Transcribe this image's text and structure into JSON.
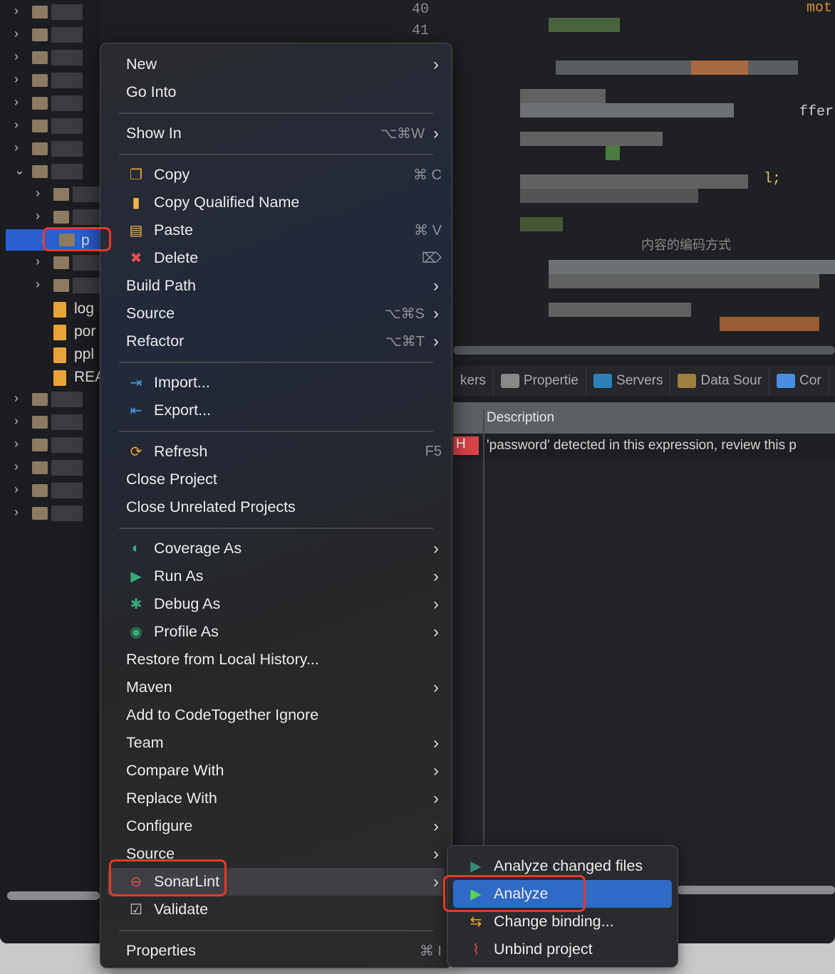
{
  "editor": {
    "line_numbers": [
      "40",
      "41"
    ],
    "visible_fragments": [
      "ffer",
      "l;",
      "内容的编码方式",
      "mot"
    ]
  },
  "tree": {
    "visible_labels": [
      "p",
      "log",
      "por",
      "ppl",
      "REA"
    ],
    "selected": "p"
  },
  "bottom_panel": {
    "tabs": [
      {
        "label": "kers",
        "icon": "markers-icon"
      },
      {
        "label": "Propertie",
        "icon": "properties-icon"
      },
      {
        "label": "Servers",
        "icon": "servers-icon"
      },
      {
        "label": "Data Sour",
        "icon": "data-source-icon"
      },
      {
        "label": "Cor",
        "icon": "console-icon"
      }
    ],
    "column_header": "Description",
    "rows": [
      {
        "severity": "H",
        "description": "'password' detected in this expression, review this p"
      }
    ]
  },
  "context_menu": {
    "items": [
      {
        "label": "New",
        "submenu": true
      },
      {
        "label": "Go Into"
      },
      {
        "sep": true
      },
      {
        "label": "Show In",
        "shortcut": "⌥⌘W",
        "submenu": true
      },
      {
        "sep": true
      },
      {
        "label": "Copy",
        "shortcut": "⌘ C",
        "icon": "copy-icon"
      },
      {
        "label": "Copy Qualified Name",
        "icon": "copy-qualified-name-icon"
      },
      {
        "label": "Paste",
        "shortcut": "⌘ V",
        "icon": "paste-icon"
      },
      {
        "label": "Delete",
        "shortcut": "⌦",
        "icon": "delete-icon"
      },
      {
        "label": "Build Path",
        "submenu": true
      },
      {
        "label": "Source",
        "shortcut": "⌥⌘S",
        "submenu": true
      },
      {
        "label": "Refactor",
        "shortcut": "⌥⌘T",
        "submenu": true
      },
      {
        "sep": true
      },
      {
        "label": "Import...",
        "icon": "import-icon"
      },
      {
        "label": "Export...",
        "icon": "export-icon"
      },
      {
        "sep": true
      },
      {
        "label": "Refresh",
        "shortcut": "F5",
        "icon": "refresh-icon"
      },
      {
        "label": "Close Project"
      },
      {
        "label": "Close Unrelated Projects"
      },
      {
        "sep": true
      },
      {
        "label": "Coverage As",
        "icon": "coverage-icon",
        "submenu": true
      },
      {
        "label": "Run As",
        "icon": "run-icon",
        "submenu": true
      },
      {
        "label": "Debug As",
        "icon": "debug-icon",
        "submenu": true
      },
      {
        "label": "Profile As",
        "icon": "profile-icon",
        "submenu": true
      },
      {
        "label": "Restore from Local History..."
      },
      {
        "label": "Maven",
        "submenu": true
      },
      {
        "label": "Add to CodeTogether Ignore"
      },
      {
        "label": "Team",
        "submenu": true
      },
      {
        "label": "Compare With",
        "submenu": true
      },
      {
        "label": "Replace With",
        "submenu": true
      },
      {
        "label": "Configure",
        "submenu": true
      },
      {
        "label": "Source",
        "submenu": true
      },
      {
        "label": "SonarLint",
        "icon": "sonarlint-icon",
        "submenu": true,
        "highlighted": true
      },
      {
        "label": "Validate",
        "icon": "validate-icon"
      },
      {
        "sep": true
      },
      {
        "label": "Properties",
        "shortcut": "⌘ I"
      }
    ]
  },
  "sonarlint_submenu": {
    "items": [
      {
        "label": "Analyze changed files",
        "icon": "analyze-changed-icon"
      },
      {
        "label": "Analyze",
        "icon": "play-icon",
        "active": true
      },
      {
        "label": "Change binding...",
        "icon": "change-binding-icon"
      },
      {
        "label": "Unbind project",
        "icon": "unbind-icon"
      }
    ]
  },
  "colors": {
    "selection": "#2a5fd0",
    "submenu_active": "#2e6bc6",
    "annotation": "#e33a2a",
    "severity_high": "#d9434a"
  }
}
